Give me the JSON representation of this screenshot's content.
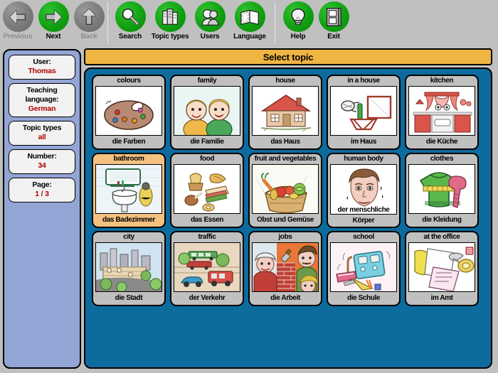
{
  "toolbar": {
    "nav_buttons": [
      {
        "label": "Previous",
        "icon": "arrow-left-icon",
        "enabled": false
      },
      {
        "label": "Next",
        "icon": "arrow-right-icon",
        "enabled": true
      },
      {
        "label": "Back",
        "icon": "arrow-up-icon",
        "enabled": false
      }
    ],
    "action_buttons": [
      {
        "label": "Search",
        "icon": "magnifier-icon",
        "enabled": true
      },
      {
        "label": "Topic types",
        "icon": "books-icon",
        "enabled": true
      },
      {
        "label": "Users",
        "icon": "people-icon",
        "enabled": true
      },
      {
        "label": "Language",
        "icon": "flag-book-icon",
        "enabled": true
      }
    ],
    "system_buttons": [
      {
        "label": "Help",
        "icon": "lightbulb-icon",
        "enabled": true
      },
      {
        "label": "Exit",
        "icon": "door-icon",
        "enabled": true
      }
    ]
  },
  "sidebar": {
    "items": [
      {
        "key": "User:",
        "value": "Thomas"
      },
      {
        "key": "Teaching language:",
        "value": "German"
      },
      {
        "key": "Topic types",
        "value": "all"
      },
      {
        "key": "Number:",
        "value": "34"
      },
      {
        "key": "Page:",
        "value": "1 / 3"
      }
    ]
  },
  "main": {
    "title": "Select topic",
    "topics": [
      {
        "title": "colours",
        "label": "die Farben",
        "selected": false,
        "art": "palette"
      },
      {
        "title": "family",
        "label": "die Familie",
        "selected": false,
        "art": "family"
      },
      {
        "title": "house",
        "label": "das Haus",
        "selected": false,
        "art": "house"
      },
      {
        "title": "in a house",
        "label": "im Haus",
        "selected": false,
        "art": "inhouse"
      },
      {
        "title": "kitchen",
        "label": "die Küche",
        "selected": false,
        "art": "kitchen"
      },
      {
        "title": "bathroom",
        "label": "das Badezimmer",
        "selected": true,
        "art": "bathroom"
      },
      {
        "title": "food",
        "label": "das Essen",
        "selected": false,
        "art": "food"
      },
      {
        "title": "fruit and vegetables",
        "label": "Obst und Gemüse",
        "selected": false,
        "art": "fruit"
      },
      {
        "title": "human body",
        "label": "der menschliche\nKörper",
        "selected": false,
        "art": "body"
      },
      {
        "title": "clothes",
        "label": "die Kleidung",
        "selected": false,
        "art": "clothes"
      },
      {
        "title": "city",
        "label": "die Stadt",
        "selected": false,
        "art": "city"
      },
      {
        "title": "traffic",
        "label": "der Verkehr",
        "selected": false,
        "art": "traffic"
      },
      {
        "title": "jobs",
        "label": "die Arbeit",
        "selected": false,
        "art": "jobs"
      },
      {
        "title": "school",
        "label": "die Schule",
        "selected": false,
        "art": "school"
      },
      {
        "title": "at the office",
        "label": "im Amt",
        "selected": false,
        "art": "office"
      }
    ]
  },
  "colors": {
    "toolbar_bg": "#c0c0c0",
    "sidebar_bg": "#93a5d4",
    "panel_bg": "#0d6b9e",
    "title_bg": "#efb441",
    "card_bg": "#c0c0c0",
    "card_selected_bg": "#f5c181",
    "value_text": "#b00000",
    "icon_on": "#13a313",
    "icon_off": "#7d7d7d"
  }
}
